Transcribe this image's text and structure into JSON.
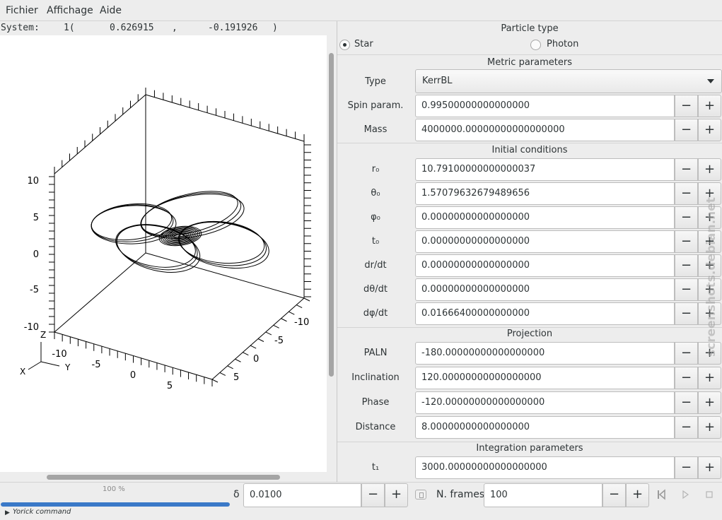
{
  "menu": [
    "Fichier",
    "Affichage",
    "Aide"
  ],
  "status": {
    "label": "System:",
    "index": "1(",
    "x": "0.626915",
    "comma": ",",
    "y": "-0.191926",
    "close": ")"
  },
  "plot": {
    "left_ticks": [
      "10",
      "5",
      "0",
      "-5",
      "-10"
    ],
    "bottom_left_ticks": [
      "-10",
      "-5",
      "0",
      "5"
    ],
    "bottom_right_ticks": [
      "-10",
      "-5",
      "0",
      "5"
    ],
    "axis_labels": {
      "z": "Z",
      "x": "X",
      "y": "Y"
    }
  },
  "panel": {
    "particle": {
      "title": "Particle type",
      "options": [
        {
          "label": "Star",
          "checked": true
        },
        {
          "label": "Photon",
          "checked": false
        }
      ]
    },
    "metric": {
      "title": "Metric parameters",
      "type_label": "Type",
      "type_value": "KerrBL",
      "rows": [
        {
          "label": "Spin param.",
          "value": "0.99500000000000000"
        },
        {
          "label": "Mass",
          "value": "4000000.00000000000000000"
        }
      ]
    },
    "initial": {
      "title": "Initial conditions",
      "rows": [
        {
          "label": "r₀",
          "value": "10.79100000000000037"
        },
        {
          "label": "θ₀",
          "value": "1.57079632679489656"
        },
        {
          "label": "φ₀",
          "value": "0.00000000000000000"
        },
        {
          "label": "t₀",
          "value": "0.00000000000000000"
        },
        {
          "label": "dr/dt",
          "value": "0.00000000000000000"
        },
        {
          "label": "dθ/dt",
          "value": "0.00000000000000000"
        },
        {
          "label": "dφ/dt",
          "value": "0.01666400000000000"
        }
      ]
    },
    "projection": {
      "title": "Projection",
      "rows": [
        {
          "label": "PALN",
          "value": "-180.00000000000000000"
        },
        {
          "label": "Inclination",
          "value": "120.00000000000000000"
        },
        {
          "label": "Phase",
          "value": "-120.00000000000000000"
        },
        {
          "label": "Distance",
          "value": "8.00000000000000000"
        }
      ]
    },
    "integration": {
      "title": "Integration parameters",
      "rows": [
        {
          "label": "t₁",
          "value": "3000.00000000000000000"
        }
      ]
    },
    "minus": "−",
    "plus": "+"
  },
  "bottom": {
    "progress_text": "100 %",
    "progress_fraction": 1.0,
    "yorick_label": "Yorick command",
    "delta_label": "δ",
    "delta_value": "0.0100",
    "nframes_label": "N. frames",
    "nframes_value": "100",
    "icons": [
      "reset-icon",
      "rewind-icon",
      "play-icon",
      "stop-icon"
    ]
  },
  "watermark": "screenshots.debian.net"
}
